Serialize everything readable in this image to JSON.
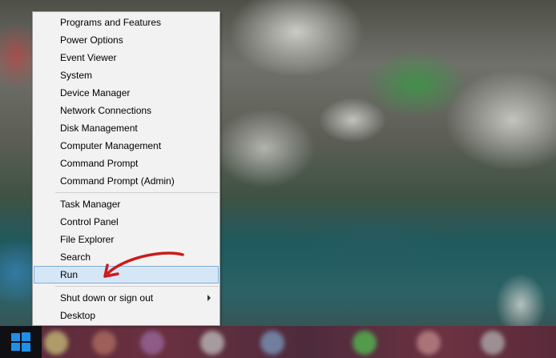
{
  "context_menu": {
    "group1": [
      {
        "label": "Programs and Features"
      },
      {
        "label": "Power Options"
      },
      {
        "label": "Event Viewer"
      },
      {
        "label": "System"
      },
      {
        "label": "Device Manager"
      },
      {
        "label": "Network Connections"
      },
      {
        "label": "Disk Management"
      },
      {
        "label": "Computer Management"
      },
      {
        "label": "Command Prompt"
      },
      {
        "label": "Command Prompt (Admin)"
      }
    ],
    "group2": [
      {
        "label": "Task Manager"
      },
      {
        "label": "Control Panel"
      },
      {
        "label": "File Explorer"
      },
      {
        "label": "Search"
      },
      {
        "label": "Run"
      }
    ],
    "group3": [
      {
        "label": "Shut down or sign out"
      },
      {
        "label": "Desktop"
      }
    ],
    "highlighted_item": "Run"
  },
  "taskbar": {
    "start_icon": "windows-logo-icon"
  },
  "colors": {
    "menu_background": "#f2f2f2",
    "highlight_background": "#d5e6f7",
    "highlight_border": "#7daedd",
    "annotation_arrow": "#cc1a1a",
    "start_logo": "#1e90e8"
  }
}
